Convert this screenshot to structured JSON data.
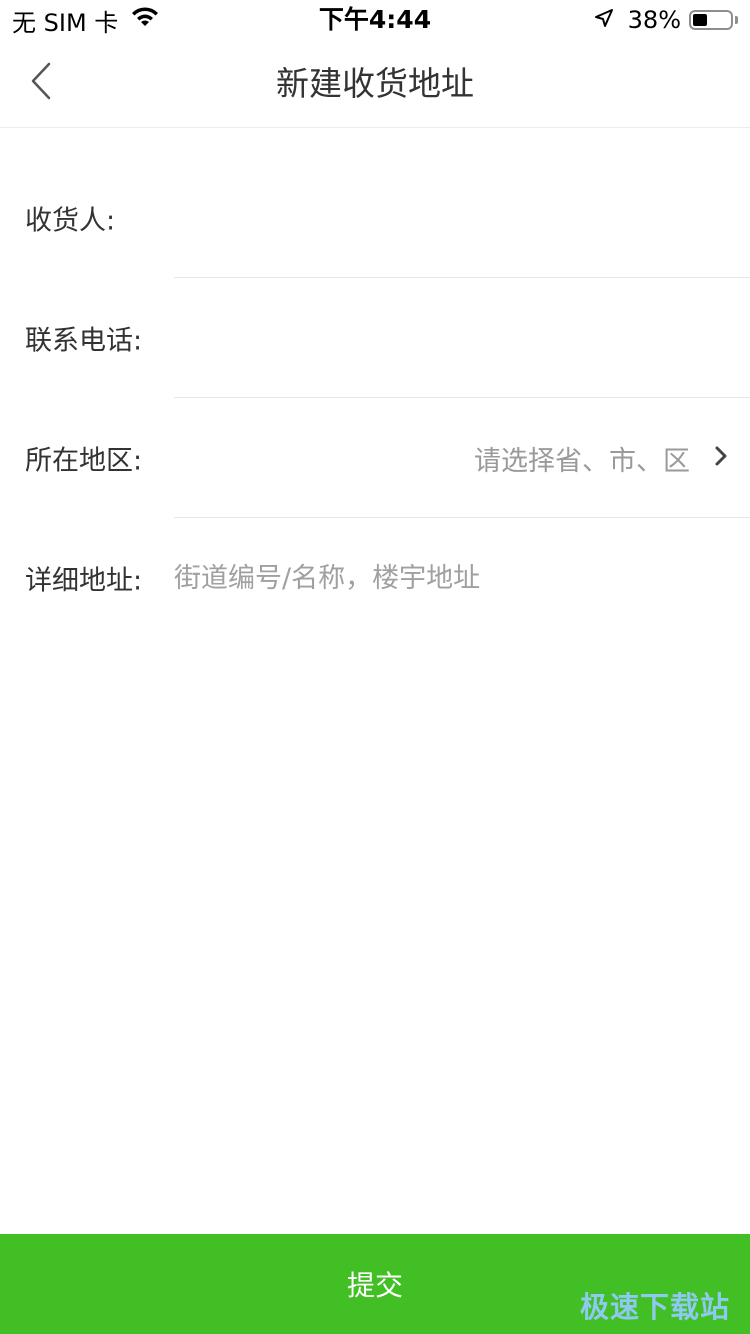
{
  "status_bar": {
    "carrier": "无 SIM 卡",
    "time": "下午4:44",
    "battery_percent": "38%",
    "battery_level": 0.38,
    "icons": [
      "wifi-icon",
      "location-arrow-icon",
      "battery-icon"
    ]
  },
  "nav": {
    "title": "新建收货地址",
    "back_icon": "chevron-left-icon"
  },
  "form": {
    "receiver_label": "收货人:",
    "receiver_value": "",
    "phone_label": "联系电话:",
    "phone_value": "",
    "region_label": "所在地区:",
    "region_placeholder": "请选择省、市、区",
    "detail_label": "详细地址:",
    "detail_placeholder": "街道编号/名称，楼宇地址",
    "detail_value": ""
  },
  "submit": {
    "label": "提交"
  },
  "watermark": {
    "text": "极速下载站"
  },
  "colors": {
    "accent": "#41bf25",
    "placeholder": "#9a9a9a",
    "divider": "#e6e6e6",
    "watermark": "#8ec9f0"
  }
}
